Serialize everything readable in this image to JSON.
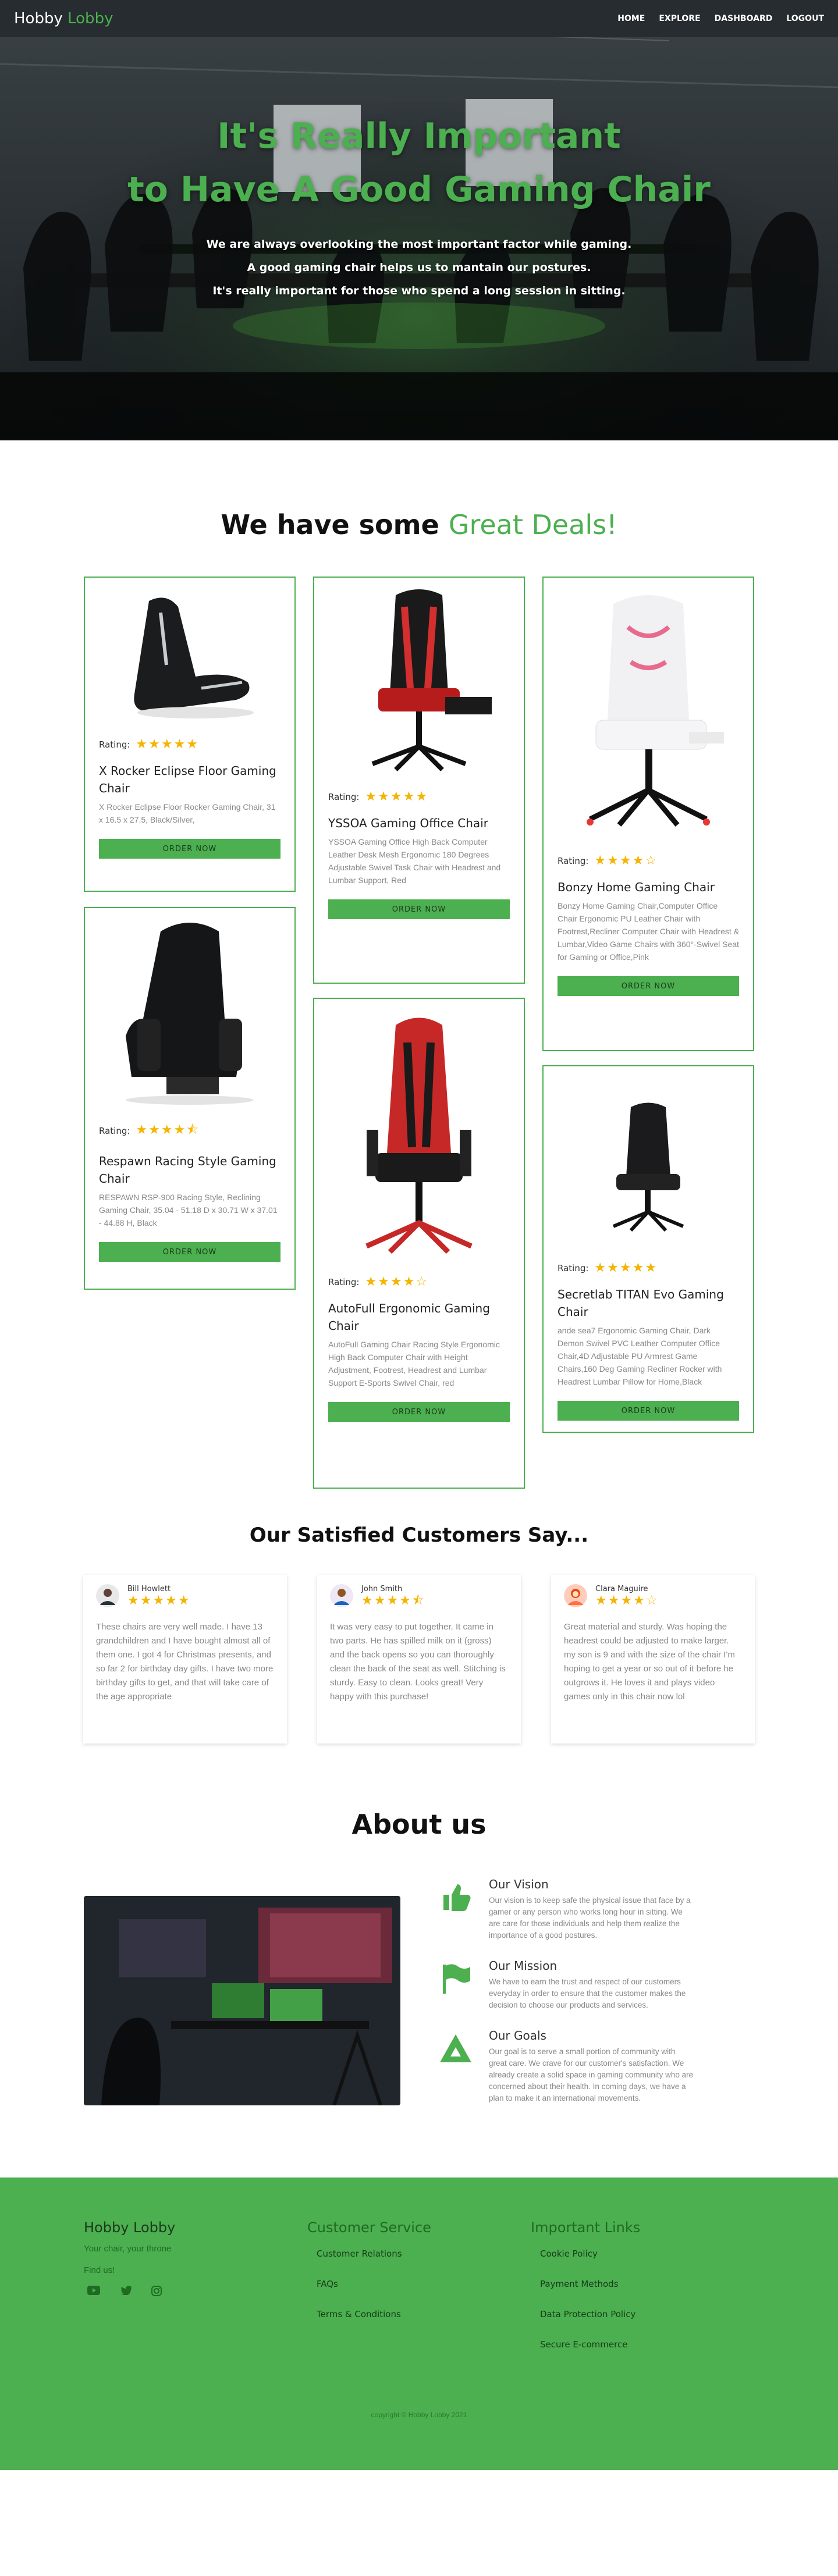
{
  "nav": {
    "brand_main": "Hobby",
    "brand_accent": "Lobby",
    "links": [
      "HOME",
      "EXPLORE",
      "DASHBOARD",
      "LOGOUT"
    ]
  },
  "hero": {
    "title_line1": "It's Really Important",
    "title_line2": "to Have A Good Gaming Chair",
    "subtitle_lines": [
      "We are always overlooking the most important factor while gaming.",
      "A good gaming chair helps us to mantain our postures.",
      "It's really important for those who spend a long session in sitting."
    ]
  },
  "deals": {
    "heading_main": "We have some",
    "heading_accent": "Great Deals!",
    "rating_label": "Rating:",
    "order_label": "ORDER NOW",
    "products": [
      {
        "title": "X Rocker Eclipse Floor Gaming Chair",
        "stars": "★★★★★",
        "rating": 5,
        "desc": "X Rocker Eclipse Floor Rocker Gaming Chair, 31 x 16.5 x 27.5, Black/Silver,"
      },
      {
        "title": "Respawn Racing Style Gaming Chair",
        "stars": "★★★★⯪",
        "rating": 4.5,
        "desc": "RESPAWN RSP-900 Racing Style, Reclining Gaming Chair, 35.04 - 51.18 D x 30.71 W x 37.01 - 44.88 H, Black"
      },
      {
        "title": "YSSOA Gaming Office Chair",
        "stars": "★★★★★",
        "rating": 5,
        "desc": "YSSOA Gaming Office High Back Computer Leather Desk Mesh Ergonomic 180 Degrees Adjustable Swivel Task Chair with Headrest and Lumbar Support, Red"
      },
      {
        "title": "AutoFull Ergonomic Gaming Chair",
        "stars": "★★★★☆",
        "rating": 4,
        "desc": "AutoFull Gaming Chair Racing Style Ergonomic High Back Computer Chair with Height Adjustment, Footrest, Headrest and Lumbar Support E-Sports Swivel Chair,  red"
      },
      {
        "title": "Bonzy Home Gaming Chair",
        "stars": "★★★★☆",
        "rating": 4,
        "desc": "Bonzy Home Gaming Chair,Computer Office Chair Ergonomic PU Leather Chair with Footrest,Recliner Computer Chair with Headrest & Lumbar,Video Game Chairs with 360°-Swivel Seat for Gaming or Office,Pink"
      },
      {
        "title": "Secretlab TITAN Evo Gaming Chair",
        "stars": "★★★★★",
        "rating": 5,
        "desc": "ande sea7 Ergonomic Gaming Chair, Dark Demon Swivel PVC Leather Computer Office Chair,4D Adjustable PU Armrest Game Chairs,160 Deg Gaming Recliner Rocker with Headrest Lumbar Pillow for Home,Black"
      }
    ]
  },
  "testimonials": {
    "heading": "Our Satisfied Customers Say...",
    "items": [
      {
        "name": "Bill Howlett",
        "stars": "★★★★★",
        "rating": 5,
        "text": "These chairs are very well made. I have 13 grandchildren and I have bought almost all of them one. I got 4 for Christmas presents, and so far 2 for birthday day gifts. I have two more birthday gifts to get, and that will take care of the age appropriate"
      },
      {
        "name": "John Smith",
        "stars": "★★★★⯪",
        "rating": 4.5,
        "text": "It was very easy to put together. It came in two parts. He has spilled milk on it (gross) and the back opens so you can thoroughly clean the back of the seat as well. Stitching is sturdy. Easy to clean. Looks great! Very happy with this purchase!"
      },
      {
        "name": "Clara Maguire",
        "stars": "★★★★☆",
        "rating": 4,
        "text": "Great material and sturdy. Was hoping the headrest could be adjusted to make larger. my son is 9 and with the size of the chair I'm hoping to get a year or so out of it before he outgrows it. He loves it and plays video games only in this chair now lol"
      }
    ]
  },
  "about": {
    "heading": "About us",
    "items": [
      {
        "title": "Our Vision",
        "text": "Our vision is to keep safe the physical issue that face by a gamer or any person who works long hour in sitting. We are care for those individuals and help them realize the importance of a good postures.",
        "icon": "thumbs-up-icon"
      },
      {
        "title": "Our Mission",
        "text": "We have to earn the trust and respect of our customers everyday in order to ensure that the customer makes the decision to choose our products and services.",
        "icon": "flag-icon"
      },
      {
        "title": "Our Goals",
        "text": "Our goal is to serve a small portion of community with great care. We crave for our customer's satisfaction. We already create a solid space in gaming community who are concerned about their health. In coming days, we have a plan to make it an international movements.",
        "icon": "triangle-icon"
      }
    ]
  },
  "footer": {
    "brand": "Hobby Lobby",
    "tagline": "Your chair, your throne",
    "find_us": "Find us!",
    "service_heading": "Customer Service",
    "service_links": [
      "Customer Relations",
      "FAQs",
      "Terms & Conditions"
    ],
    "links_heading": "Important Links",
    "important_links": [
      "Cookie Policy",
      "Payment Methods",
      "Data Protection Policy",
      "Secure E-commerce"
    ],
    "copyright": "copyright © Hobby Lobby 2021"
  },
  "colors": {
    "accent": "#4caf50",
    "star": "#f5b400",
    "nav": "#262c30"
  }
}
